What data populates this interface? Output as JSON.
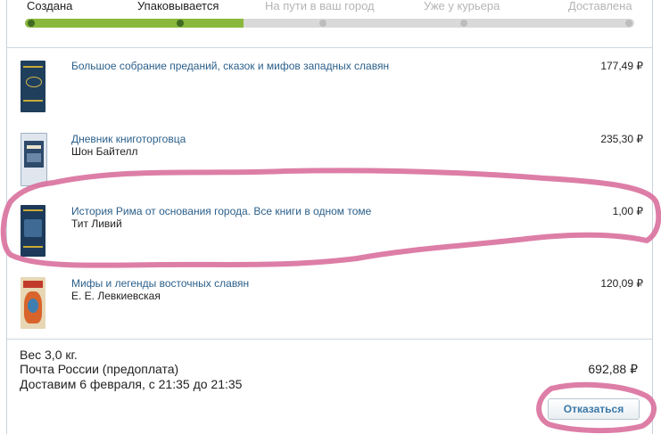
{
  "status": {
    "steps": [
      {
        "label": "Создана",
        "done": true
      },
      {
        "label": "Упаковывается",
        "done": true
      },
      {
        "label": "На пути в ваш город",
        "done": false
      },
      {
        "label": "Уже у курьера",
        "done": false
      },
      {
        "label": "Доставлена",
        "done": false
      }
    ]
  },
  "items": [
    {
      "title": "Большое собрание преданий, сказок и мифов западных славян",
      "author": "",
      "price": "177,49 ₽"
    },
    {
      "title": "Дневник книготорговца",
      "author": "Шон Байтелл",
      "price": "235,30 ₽"
    },
    {
      "title": "История Рима от основания города. Все книги в одном томе",
      "author": "Тит Ливий",
      "price": "1,00 ₽"
    },
    {
      "title": "Мифы и легенды восточных славян",
      "author": "Е. Е. Левкиевская",
      "price": "120,09 ₽"
    }
  ],
  "summary": {
    "weight": "Вес 3,0 кг.",
    "delivery_method": "Почта России (предоплата)",
    "delivery_time": "Доставим 6 февраля, с 21:35 до 21:35",
    "total": "692,88 ₽"
  },
  "actions": {
    "cancel_label": "Отказаться"
  },
  "colors": {
    "progress_done": "#8ab83c",
    "progress_todo": "#d9d9d9",
    "link": "#2b5f8a",
    "annotation": "#d9709d"
  },
  "icons": {
    "book_covers": [
      "book-cover-icon",
      "book-cover-icon",
      "book-cover-icon",
      "book-cover-icon"
    ]
  }
}
